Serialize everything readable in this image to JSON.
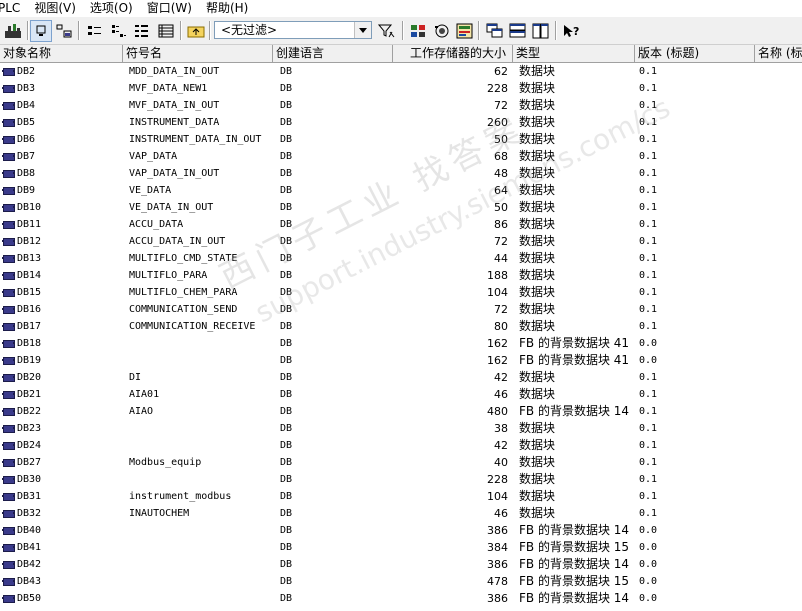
{
  "menu": [
    "PLC",
    "视图(V)",
    "选项(O)",
    "窗口(W)",
    "帮助(H)"
  ],
  "toolbar": {
    "icons": [
      "accessible-nodes-icon",
      "large-icons-icon",
      "small-icons-icon",
      "list-icon",
      "details-icon",
      "tree-icon",
      "go-up-icon",
      "filter-icon",
      "simulation-icon",
      "monitor-icon",
      "module-info-icon",
      "cascade-icon",
      "arrange-horizontal-icon",
      "arrange-vertical-icon",
      "help-icon"
    ],
    "filter_value": "<无过滤>"
  },
  "columns": [
    "对象名称",
    "符号名",
    "创建语言",
    "工作存储器的大小",
    "类型",
    "版本 (标题)",
    "名称 (标"
  ],
  "rows": [
    {
      "name": "DB2",
      "symbol": "MDD_DATA_IN_OUT",
      "lang": "DB",
      "size": "62",
      "type": "数据块",
      "version": "0.1"
    },
    {
      "name": "DB3",
      "symbol": "MVF_DATA_NEW1",
      "lang": "DB",
      "size": "228",
      "type": "数据块",
      "version": "0.1"
    },
    {
      "name": "DB4",
      "symbol": "MVF_DATA_IN_OUT",
      "lang": "DB",
      "size": "72",
      "type": "数据块",
      "version": "0.1"
    },
    {
      "name": "DB5",
      "symbol": "INSTRUMENT_DATA",
      "lang": "DB",
      "size": "260",
      "type": "数据块",
      "version": "0.1"
    },
    {
      "name": "DB6",
      "symbol": "INSTRUMENT_DATA_IN_OUT",
      "lang": "DB",
      "size": "50",
      "type": "数据块",
      "version": "0.1"
    },
    {
      "name": "DB7",
      "symbol": "VAP_DATA",
      "lang": "DB",
      "size": "68",
      "type": "数据块",
      "version": "0.1"
    },
    {
      "name": "DB8",
      "symbol": "VAP_DATA_IN_OUT",
      "lang": "DB",
      "size": "48",
      "type": "数据块",
      "version": "0.1"
    },
    {
      "name": "DB9",
      "symbol": "VE_DATA",
      "lang": "DB",
      "size": "64",
      "type": "数据块",
      "version": "0.1"
    },
    {
      "name": "DB10",
      "symbol": "VE_DATA_IN_OUT",
      "lang": "DB",
      "size": "50",
      "type": "数据块",
      "version": "0.1"
    },
    {
      "name": "DB11",
      "symbol": "ACCU_DATA",
      "lang": "DB",
      "size": "86",
      "type": "数据块",
      "version": "0.1"
    },
    {
      "name": "DB12",
      "symbol": "ACCU_DATA_IN_OUT",
      "lang": "DB",
      "size": "72",
      "type": "数据块",
      "version": "0.1"
    },
    {
      "name": "DB13",
      "symbol": "MULTIFLO_CMD_STATE",
      "lang": "DB",
      "size": "44",
      "type": "数据块",
      "version": "0.1"
    },
    {
      "name": "DB14",
      "symbol": "MULTIFLO_PARA",
      "lang": "DB",
      "size": "188",
      "type": "数据块",
      "version": "0.1"
    },
    {
      "name": "DB15",
      "symbol": "MULTIFLO_CHEM_PARA",
      "lang": "DB",
      "size": "104",
      "type": "数据块",
      "version": "0.1"
    },
    {
      "name": "DB16",
      "symbol": "COMMUNICATION_SEND",
      "lang": "DB",
      "size": "72",
      "type": "数据块",
      "version": "0.1"
    },
    {
      "name": "DB17",
      "symbol": "COMMUNICATION_RECEIVE",
      "lang": "DB",
      "size": "80",
      "type": "数据块",
      "version": "0.1"
    },
    {
      "name": "DB18",
      "symbol": "",
      "lang": "DB",
      "size": "162",
      "type": "FB 的背景数据块 41",
      "version": "0.0"
    },
    {
      "name": "DB19",
      "symbol": "",
      "lang": "DB",
      "size": "162",
      "type": "FB 的背景数据块 41",
      "version": "0.0"
    },
    {
      "name": "DB20",
      "symbol": "DI",
      "lang": "DB",
      "size": "42",
      "type": "数据块",
      "version": "0.1"
    },
    {
      "name": "DB21",
      "symbol": "AIA01",
      "lang": "DB",
      "size": "46",
      "type": "数据块",
      "version": "0.1"
    },
    {
      "name": "DB22",
      "symbol": "AIAO",
      "lang": "DB",
      "size": "480",
      "type": "FB 的背景数据块 14",
      "version": "0.1"
    },
    {
      "name": "DB23",
      "symbol": "",
      "lang": "DB",
      "size": "38",
      "type": "数据块",
      "version": "0.1"
    },
    {
      "name": "DB24",
      "symbol": "",
      "lang": "DB",
      "size": "42",
      "type": "数据块",
      "version": "0.1"
    },
    {
      "name": "DB27",
      "symbol": "Modbus_equip",
      "lang": "DB",
      "size": "40",
      "type": "数据块",
      "version": "0.1"
    },
    {
      "name": "DB30",
      "symbol": "",
      "lang": "DB",
      "size": "228",
      "type": "数据块",
      "version": "0.1"
    },
    {
      "name": "DB31",
      "symbol": "instrument_modbus",
      "lang": "DB",
      "size": "104",
      "type": "数据块",
      "version": "0.1"
    },
    {
      "name": "DB32",
      "symbol": "INAUTOCHEM",
      "lang": "DB",
      "size": "46",
      "type": "数据块",
      "version": "0.1"
    },
    {
      "name": "DB40",
      "symbol": "",
      "lang": "DB",
      "size": "386",
      "type": "FB 的背景数据块 14",
      "version": "0.0"
    },
    {
      "name": "DB41",
      "symbol": "",
      "lang": "DB",
      "size": "384",
      "type": "FB 的背景数据块 15",
      "version": "0.0"
    },
    {
      "name": "DB42",
      "symbol": "",
      "lang": "DB",
      "size": "386",
      "type": "FB 的背景数据块 14",
      "version": "0.0"
    },
    {
      "name": "DB43",
      "symbol": "",
      "lang": "DB",
      "size": "478",
      "type": "FB 的背景数据块 15",
      "version": "0.0"
    },
    {
      "name": "DB50",
      "symbol": "",
      "lang": "DB",
      "size": "386",
      "type": "FB 的背景数据块 14",
      "version": "0.0"
    }
  ],
  "watermark": {
    "line1": "西门子工业 找答案",
    "line2": "support.industry.siemens.com/cs"
  }
}
